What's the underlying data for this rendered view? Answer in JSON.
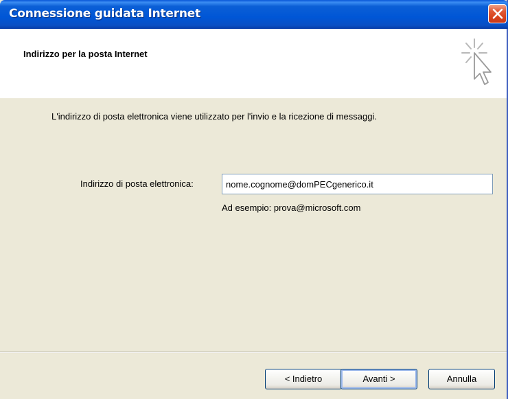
{
  "window": {
    "title": "Connessione guidata Internet"
  },
  "header": {
    "title": "Indirizzo per la posta Internet",
    "logo_icon": "wizard-cursor-icon"
  },
  "body": {
    "intro": "L'indirizzo di posta elettronica viene utilizzato per l'invio e la ricezione di messaggi.",
    "email_label": "Indirizzo di posta elettronica:",
    "email_value": "nome.cognome@domPECgenerico.it",
    "example": "Ad esempio: prova@microsoft.com"
  },
  "buttons": {
    "back": "< Indietro",
    "next": "Avanti >",
    "cancel": "Annulla"
  },
  "colors": {
    "titlebar": "#0056d6",
    "background": "#ece9d8",
    "close": "#d8431c"
  }
}
